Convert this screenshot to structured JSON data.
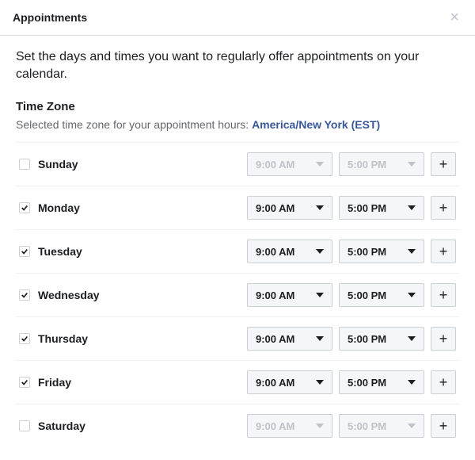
{
  "header": {
    "title": "Appointments"
  },
  "description": "Set the days and times you want to regularly offer appointments on your calendar.",
  "timezone": {
    "section_title": "Time Zone",
    "prefix": "Selected time zone for your appointment hours: ",
    "value": "America/New York (EST)"
  },
  "days": [
    {
      "name": "Sunday",
      "enabled": false,
      "start": "9:00 AM",
      "end": "5:00 PM"
    },
    {
      "name": "Monday",
      "enabled": true,
      "start": "9:00 AM",
      "end": "5:00 PM"
    },
    {
      "name": "Tuesday",
      "enabled": true,
      "start": "9:00 AM",
      "end": "5:00 PM"
    },
    {
      "name": "Wednesday",
      "enabled": true,
      "start": "9:00 AM",
      "end": "5:00 PM"
    },
    {
      "name": "Thursday",
      "enabled": true,
      "start": "9:00 AM",
      "end": "5:00 PM"
    },
    {
      "name": "Friday",
      "enabled": true,
      "start": "9:00 AM",
      "end": "5:00 PM"
    },
    {
      "name": "Saturday",
      "enabled": false,
      "start": "9:00 AM",
      "end": "5:00 PM"
    }
  ],
  "add_label": "+"
}
